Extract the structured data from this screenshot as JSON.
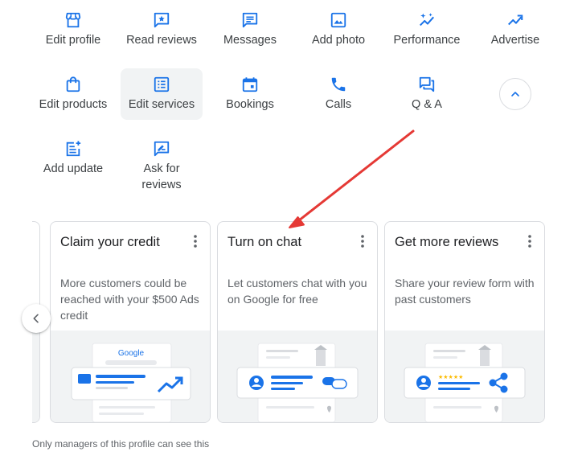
{
  "actions": [
    {
      "label": "Edit profile",
      "icon": "storefront-icon"
    },
    {
      "label": "Read reviews",
      "icon": "star-review-icon"
    },
    {
      "label": "Messages",
      "icon": "message-icon"
    },
    {
      "label": "Add photo",
      "icon": "photo-icon"
    },
    {
      "label": "Performance",
      "icon": "sparkle-trend-icon"
    },
    {
      "label": "Advertise",
      "icon": "trending-up-icon"
    },
    {
      "label": "Edit products",
      "icon": "shopping-bag-icon"
    },
    {
      "label": "Edit services",
      "icon": "list-icon"
    },
    {
      "label": "Bookings",
      "icon": "calendar-icon"
    },
    {
      "label": "Calls",
      "icon": "phone-icon"
    },
    {
      "label": "Q & A",
      "icon": "question-answer-icon"
    },
    {
      "label": "Add update",
      "icon": "post-add-icon"
    },
    {
      "label": "Ask for reviews",
      "icon": "rate-review-icon"
    }
  ],
  "cards": [
    {
      "title": "Claim your credit",
      "description": "More customers could be reached with your $500 Ads credit"
    },
    {
      "title": "Turn on chat",
      "description": "Let customers chat with you on Google for free"
    },
    {
      "title": "Get more reviews",
      "description": "Share your review form with past customers"
    }
  ],
  "illustration": {
    "google_logo_text": "Google",
    "stars": "★★★★★"
  },
  "footnote": "Only managers of this profile can see this",
  "colors": {
    "accent": "#1a73e8",
    "annotation_arrow": "#e53935",
    "star": "#fbbc04"
  }
}
